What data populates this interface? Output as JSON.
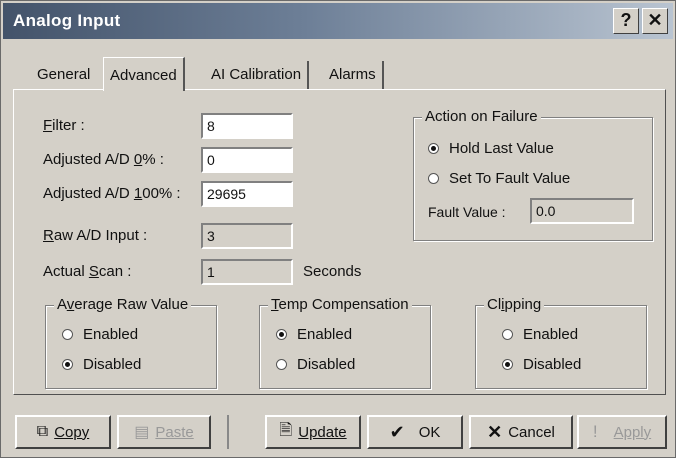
{
  "window": {
    "title": "Analog Input",
    "help_glyph": "?",
    "close_glyph": "✕"
  },
  "tabs": [
    {
      "label": "General"
    },
    {
      "label": "Advanced"
    },
    {
      "label": "AI Calibration"
    },
    {
      "label": "Alarms"
    }
  ],
  "fields": {
    "filter": {
      "label_u": "F",
      "label_rest": "ilter :",
      "value": "8"
    },
    "adj_zero": {
      "label_pre": "Adjusted A/D ",
      "label_u": "0",
      "label_rest": "% :",
      "value": "0"
    },
    "adj_hundred": {
      "label_pre": "Adjusted A/D ",
      "label_u": "1",
      "label_rest": "00% :",
      "value": "29695"
    },
    "raw_input": {
      "label_u": "R",
      "label_rest": "aw A/D Input :",
      "value": "3"
    },
    "actual_scan": {
      "label_pre": "Actual ",
      "label_u": "S",
      "label_rest": "can :",
      "value": "1",
      "unit": "Seconds"
    }
  },
  "action_on_failure": {
    "title": "Action on Failure",
    "options": [
      "Hold Last Value",
      "Set To Fault Value"
    ],
    "selected": "Hold Last Value",
    "fault_value_label": "Fault Value :",
    "fault_value": "0.0"
  },
  "average_raw": {
    "title_pre": "A",
    "title_u": "v",
    "title_rest": "erage Raw Value",
    "options": [
      "Enabled",
      "Disabled"
    ],
    "selected": "Disabled"
  },
  "temp_comp": {
    "title_u": "T",
    "title_rest": "emp Compensation",
    "options": [
      "Enabled",
      "Disabled"
    ],
    "selected": "Enabled"
  },
  "clipping": {
    "title_pre": "Cl",
    "title_u": "i",
    "title_rest": "pping",
    "options": [
      "Enabled",
      "Disabled"
    ],
    "selected": "Disabled"
  },
  "buttons": {
    "copy": {
      "label": "Copy",
      "icon": "copy-icon"
    },
    "paste": {
      "label": "Paste",
      "icon": "paste-icon"
    },
    "update": {
      "label": "Update",
      "icon": "update-icon"
    },
    "ok": {
      "label": "OK",
      "icon": "check-icon"
    },
    "cancel": {
      "label": "Cancel",
      "icon": "x-icon"
    },
    "apply": {
      "label": "Apply",
      "icon": "exclamation-icon"
    }
  }
}
